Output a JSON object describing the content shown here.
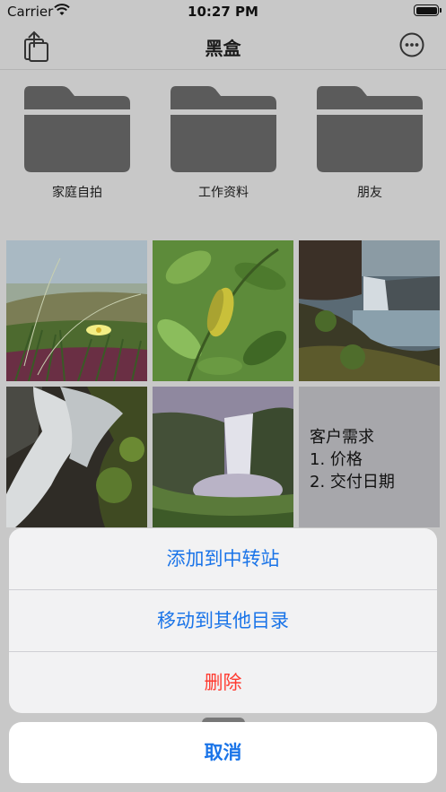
{
  "status_bar": {
    "carrier": "Carrier",
    "time": "10:27 PM"
  },
  "nav": {
    "title": "黑盒",
    "left_icon": "share-icon",
    "right_icon": "more-icon"
  },
  "folders": [
    {
      "label": "家庭自拍",
      "icon": "folder-icon"
    },
    {
      "label": "工作资料",
      "icon": "folder-icon"
    },
    {
      "label": "朋友",
      "icon": "folder-icon"
    }
  ],
  "photos": [
    {
      "icon": "photo-flower-icon"
    },
    {
      "icon": "photo-leaf-icon"
    },
    {
      "icon": "photo-coast-waterfall-icon"
    },
    {
      "icon": "photo-waterfall-closeup-icon"
    },
    {
      "icon": "photo-waterfall-valley-icon"
    }
  ],
  "note": {
    "text": "客户需求\n1. 价格\n2. 交付日期"
  },
  "action_sheet": {
    "actions": [
      {
        "label": "添加到中转站"
      },
      {
        "label": "移动到其他目录"
      },
      {
        "label": "删除"
      }
    ],
    "cancel_label": "取消"
  },
  "colors": {
    "accent": "#1a74e8",
    "destructive": "#ff3b30",
    "folder": "#5b5b5b",
    "overlay": "#c8c8c8"
  }
}
